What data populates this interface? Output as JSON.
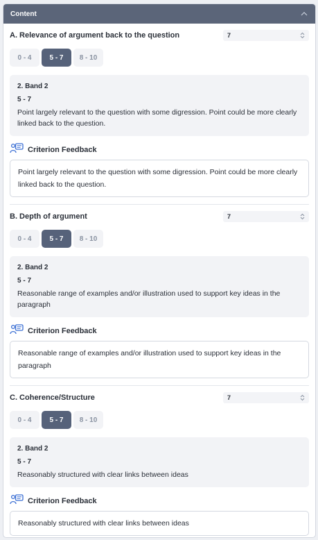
{
  "panel": {
    "title": "Content"
  },
  "criteria": [
    {
      "title": "A. Relevance of argument back to the question",
      "score": "7",
      "bands": [
        "0 - 4",
        "5 - 7",
        "8 - 10"
      ],
      "selected_band": 1,
      "band_name": "2. Band 2",
      "band_range": "5 - 7",
      "band_desc": "Point largely relevant to the question with some digression. Point could be more clearly linked back to the question.",
      "feedback_title": "Criterion Feedback",
      "feedback": "Point largely relevant to the question with some digression. Point could be more clearly linked back to the question."
    },
    {
      "title": "B. Depth of argument",
      "score": "7",
      "bands": [
        "0 - 4",
        "5 - 7",
        "8 - 10"
      ],
      "selected_band": 1,
      "band_name": "2. Band 2",
      "band_range": "5 - 7",
      "band_desc": "Reasonable range of examples and/or illustration used to support key ideas in the paragraph",
      "feedback_title": "Criterion Feedback",
      "feedback": "Reasonable range of examples and/or illustration used to support key ideas in the paragraph"
    },
    {
      "title": "C. Coherence/Structure",
      "score": "7",
      "bands": [
        "0 - 4",
        "5 - 7",
        "8 - 10"
      ],
      "selected_band": 1,
      "band_name": "2. Band 2",
      "band_range": "5 - 7",
      "band_desc": "Reasonably structured with clear links between ideas",
      "feedback_title": "Criterion Feedback",
      "feedback": "Reasonably structured with clear links between ideas"
    }
  ],
  "colors": {
    "header": "#5b6579",
    "selected_band": "#56627a",
    "icon": "#3b6fd4"
  },
  "icons": {
    "collapse": "chevron-up-icon",
    "feedback": "feedback-chat-icon",
    "spinner": "spinner-arrows-icon"
  }
}
